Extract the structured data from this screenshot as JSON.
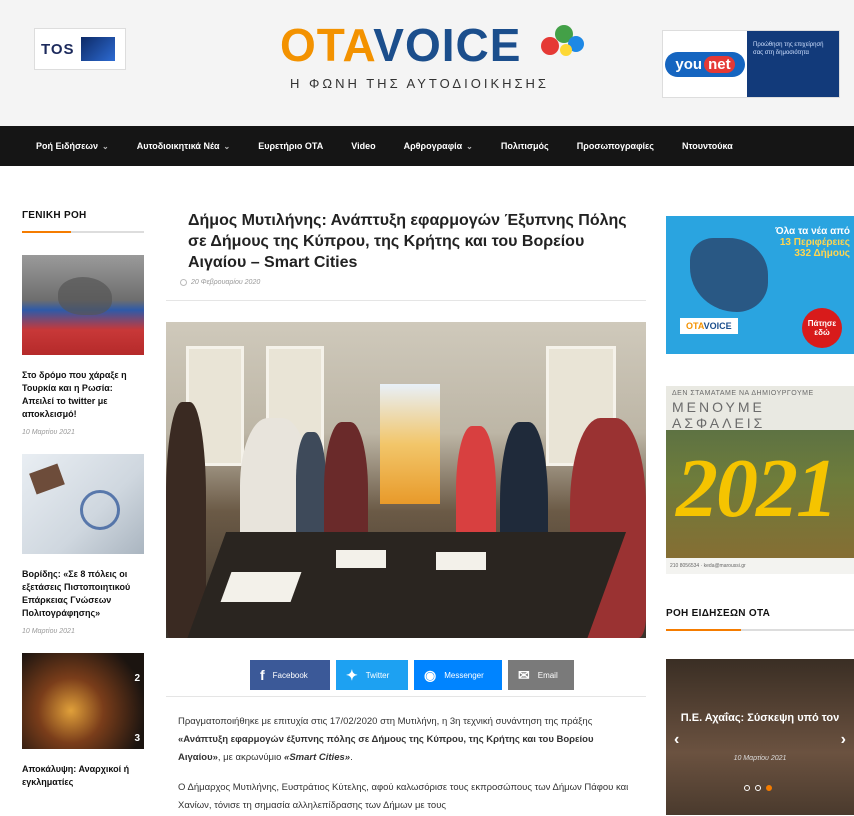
{
  "header": {
    "left_ad_text": "TOS",
    "logo_oto": "OTA",
    "logo_voice": "VOICE",
    "tagline": "Η ΦΩΝΗ ΤΗΣ ΑΥΤΟΔΙΟΙΚΗΣΗΣ",
    "right_ad_brand": "you",
    "right_ad_brand2": "net",
    "right_ad_text": "Προώθηση της επιχείρησή σας στη δημοσιότητα"
  },
  "nav": {
    "items": [
      {
        "label": "Ροή Ειδήσεων",
        "dropdown": true
      },
      {
        "label": "Αυτοδιοικητικά Νέα",
        "dropdown": true
      },
      {
        "label": "Ευρετήριο ΟΤΑ",
        "dropdown": false
      },
      {
        "label": "Video",
        "dropdown": false
      },
      {
        "label": "Αρθρογραφία",
        "dropdown": true
      },
      {
        "label": "Πολιτισμός",
        "dropdown": false
      },
      {
        "label": "Προσωπογραφίες",
        "dropdown": false
      },
      {
        "label": "Ντουντούκα",
        "dropdown": false
      }
    ]
  },
  "left": {
    "section_title": "ΓΕΝΙΚΗ ΡΟΗ",
    "posts": [
      {
        "title": "Στο δρόμο που χάραξε η Τουρκία και η Ρωσία: Απειλεί το twitter με αποκλεισμό!",
        "date": "10 Μαρτίου 2021"
      },
      {
        "title": "Βορίδης: «Σε 8 πόλεις οι εξετάσεις Πιστοποιητικού Επάρκειας Γνώσεων Πολιτογράφησης»",
        "date": "10 Μαρτίου 2021"
      },
      {
        "title": "Αποκάλυψη: Αναρχικοί ή εγκληματίες",
        "date": ""
      }
    ],
    "thumb3_numbers": [
      "2",
      "3"
    ]
  },
  "article": {
    "title": "Δήμος Μυτιλήνης: Ανάπτυξη εφαρμογών Έξυπνης Πόλης σε Δήμους της Κύπρου, της Κρήτης και του Βορείου Αιγαίου – Smart Cities",
    "date": "20 Φεβρουαρίου 2020",
    "share": {
      "facebook": "Facebook",
      "twitter": "Twitter",
      "messenger": "Messenger",
      "email": "Email"
    },
    "p1_a": "Πραγματοποιήθηκε με επιτυχία στις 17/02/2020 στη Μυτιλήνη, η 3η τεχνική συνάντηση της πράξης ",
    "p1_b": "«Ανάπτυξη εφαρμογών έξυπνης πόλης σε Δήμους της Κύπρου, της Κρήτης και του Βορείου Αιγαίου»",
    "p1_c": ", με ακρωνύμιο ",
    "p1_d": "«Smart Cities»",
    "p1_e": ".",
    "p2": "Ο Δήμαρχος Μυτιλήνης, Ευστράτιος Κύτελης, αφού καλωσόρισε τους εκπροσώπους των Δήμων Πάφου και Χανίων, τόνισε τη σημασία αλληλεπίδρασης των Δήμων με τους"
  },
  "right": {
    "ad1_line1": "Όλα τα νέα από",
    "ad1_line2": "13 Περιφέρειες",
    "ad1_line3": "332 Δήμους",
    "ad1_press": "Πάτησε εδώ",
    "ad1_logo_a": "OTA",
    "ad1_logo_b": "VOICE",
    "ad2_line1": "ΔΕΝ ΣΤΑΜΑΤΑΜΕ ΝΑ ΔΗΜΙΟΥΡΓΟΥΜΕ",
    "ad2_line2": "ΜΕΝΟΥΜΕ ΑΣΦΑΛΕΙΣ",
    "ad2_year": "2021",
    "ad2_foot": "210 8056534 · keda@maroussi.gr",
    "section_title": "ΡΟΗ ΕΙΔΗΣΕΩΝ ΟΤΑ",
    "slide_title": "Π.Ε. Αχαΐας: Σύσκεψη υπό τον",
    "slide_date": "10 Μαρτίου 2021"
  }
}
